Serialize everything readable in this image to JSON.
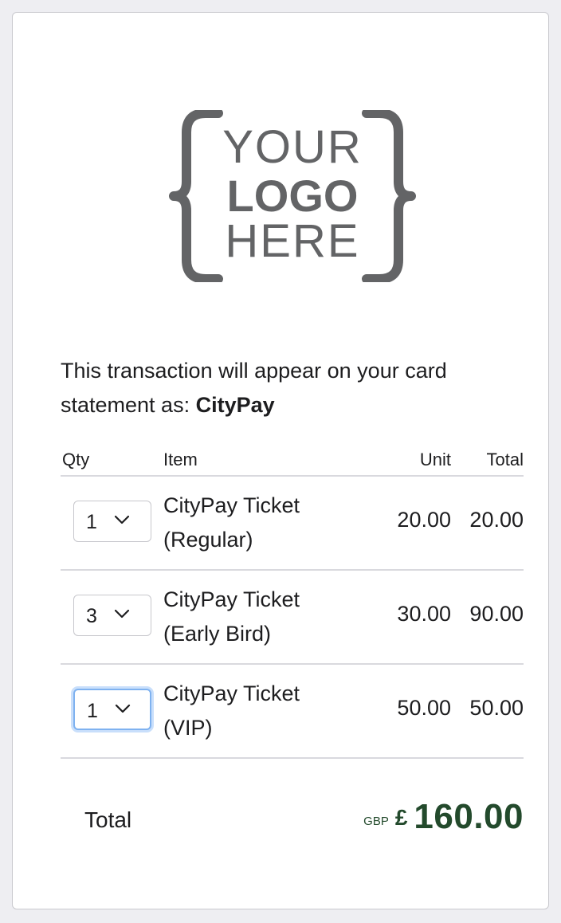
{
  "logo": {
    "line1": "YOUR",
    "line2": "LOGO",
    "line3": "HERE",
    "color": "#636466"
  },
  "descriptor": {
    "text": "This transaction will appear on your card statement as: ",
    "merchant": "CityPay"
  },
  "table": {
    "headers": {
      "qty": "Qty",
      "item": "Item",
      "unit": "Unit",
      "total": "Total"
    },
    "rows": [
      {
        "qty": "1",
        "item": "CityPay Ticket (Regular)",
        "unit": "20.00",
        "total": "20.00"
      },
      {
        "qty": "3",
        "item": "CityPay Ticket (Early Bird)",
        "unit": "30.00",
        "total": "90.00"
      },
      {
        "qty": "1",
        "item": "CityPay Ticket (VIP)",
        "unit": "50.00",
        "total": "50.00"
      }
    ]
  },
  "summary": {
    "label": "Total",
    "currency_code": "GBP",
    "currency_symbol": "£",
    "amount": "160.00",
    "amount_color": "#234a2c"
  },
  "colors": {
    "background": "#eeeef2",
    "focus_ring": "#7fb2f0"
  }
}
